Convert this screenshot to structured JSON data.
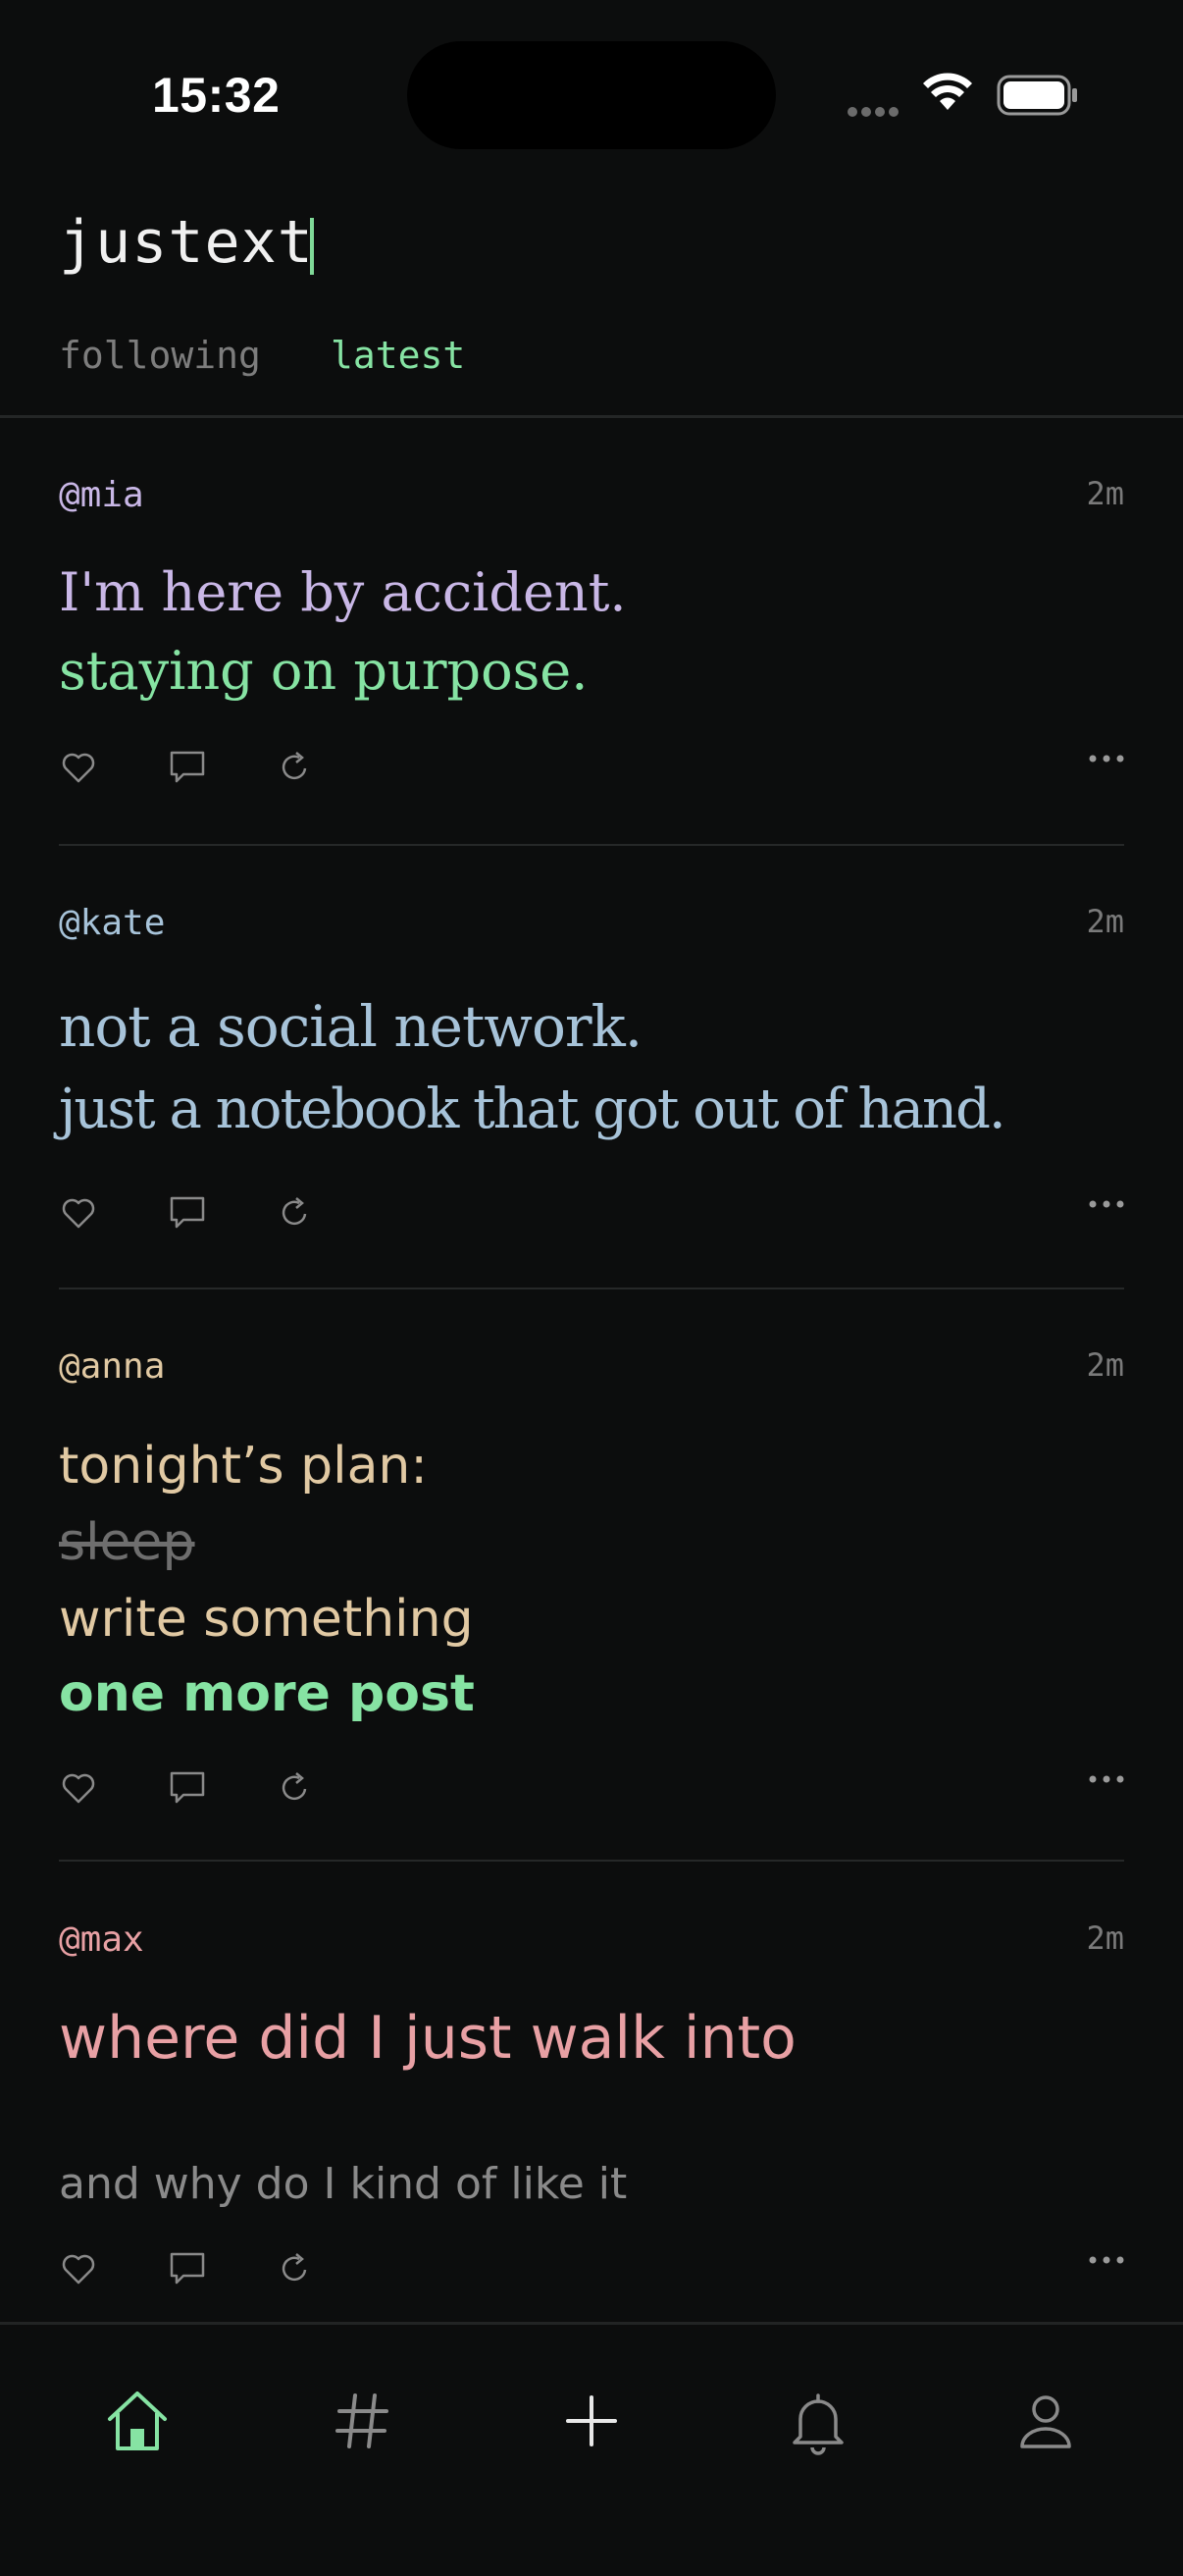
{
  "status_bar": {
    "time": "15:32"
  },
  "app": {
    "title": "justext"
  },
  "tabs": [
    {
      "label": "following",
      "active": false
    },
    {
      "label": "latest",
      "active": true
    }
  ],
  "colors": {
    "accent": "#86e3a3",
    "background": "#0c0d0d"
  },
  "posts": [
    {
      "handle": "@mia",
      "age": "2m",
      "handle_color": "#c9b7e6",
      "lines": [
        {
          "text": "I'm here by accident.",
          "color": "#c9b7e6"
        },
        {
          "text": "staying on purpose.",
          "color": "#86e3a3"
        }
      ]
    },
    {
      "handle": "@kate",
      "age": "2m",
      "handle_color": "#a7c3d9",
      "lines": [
        {
          "text": "not a social network.",
          "color": "#a7c3d9"
        },
        {
          "text": "just a notebook that got out of hand.",
          "color": "#a7c3d9"
        }
      ]
    },
    {
      "handle": "@anna",
      "age": "2m",
      "handle_color": "#e1c9a3",
      "lines": [
        {
          "text": "tonight’s plan:",
          "color": "#e1c9a3"
        },
        {
          "text": "sleep",
          "color": "#6e6e6e",
          "style": "strikethrough"
        },
        {
          "text": "write something",
          "color": "#e1c9a3"
        },
        {
          "text": "one more post",
          "color": "#86e3a3",
          "style": "bold"
        }
      ]
    },
    {
      "handle": "@max",
      "age": "2m",
      "handle_color": "#e8a0a4",
      "lines": [
        {
          "text": "where did I just walk into",
          "color": "#e8a0a4"
        },
        {
          "text": "and why do I kind of like it",
          "color": "#8a8a8a"
        }
      ]
    }
  ],
  "post_actions": [
    "heart-icon",
    "comment-icon",
    "repost-icon",
    "more-icon"
  ],
  "nav": [
    {
      "name": "home",
      "icon": "home-icon",
      "active": true
    },
    {
      "name": "tags",
      "icon": "hashtag-icon",
      "active": false
    },
    {
      "name": "compose",
      "icon": "plus-icon",
      "active": false
    },
    {
      "name": "notifications",
      "icon": "bell-icon",
      "active": false
    },
    {
      "name": "profile",
      "icon": "person-icon",
      "active": false
    }
  ]
}
